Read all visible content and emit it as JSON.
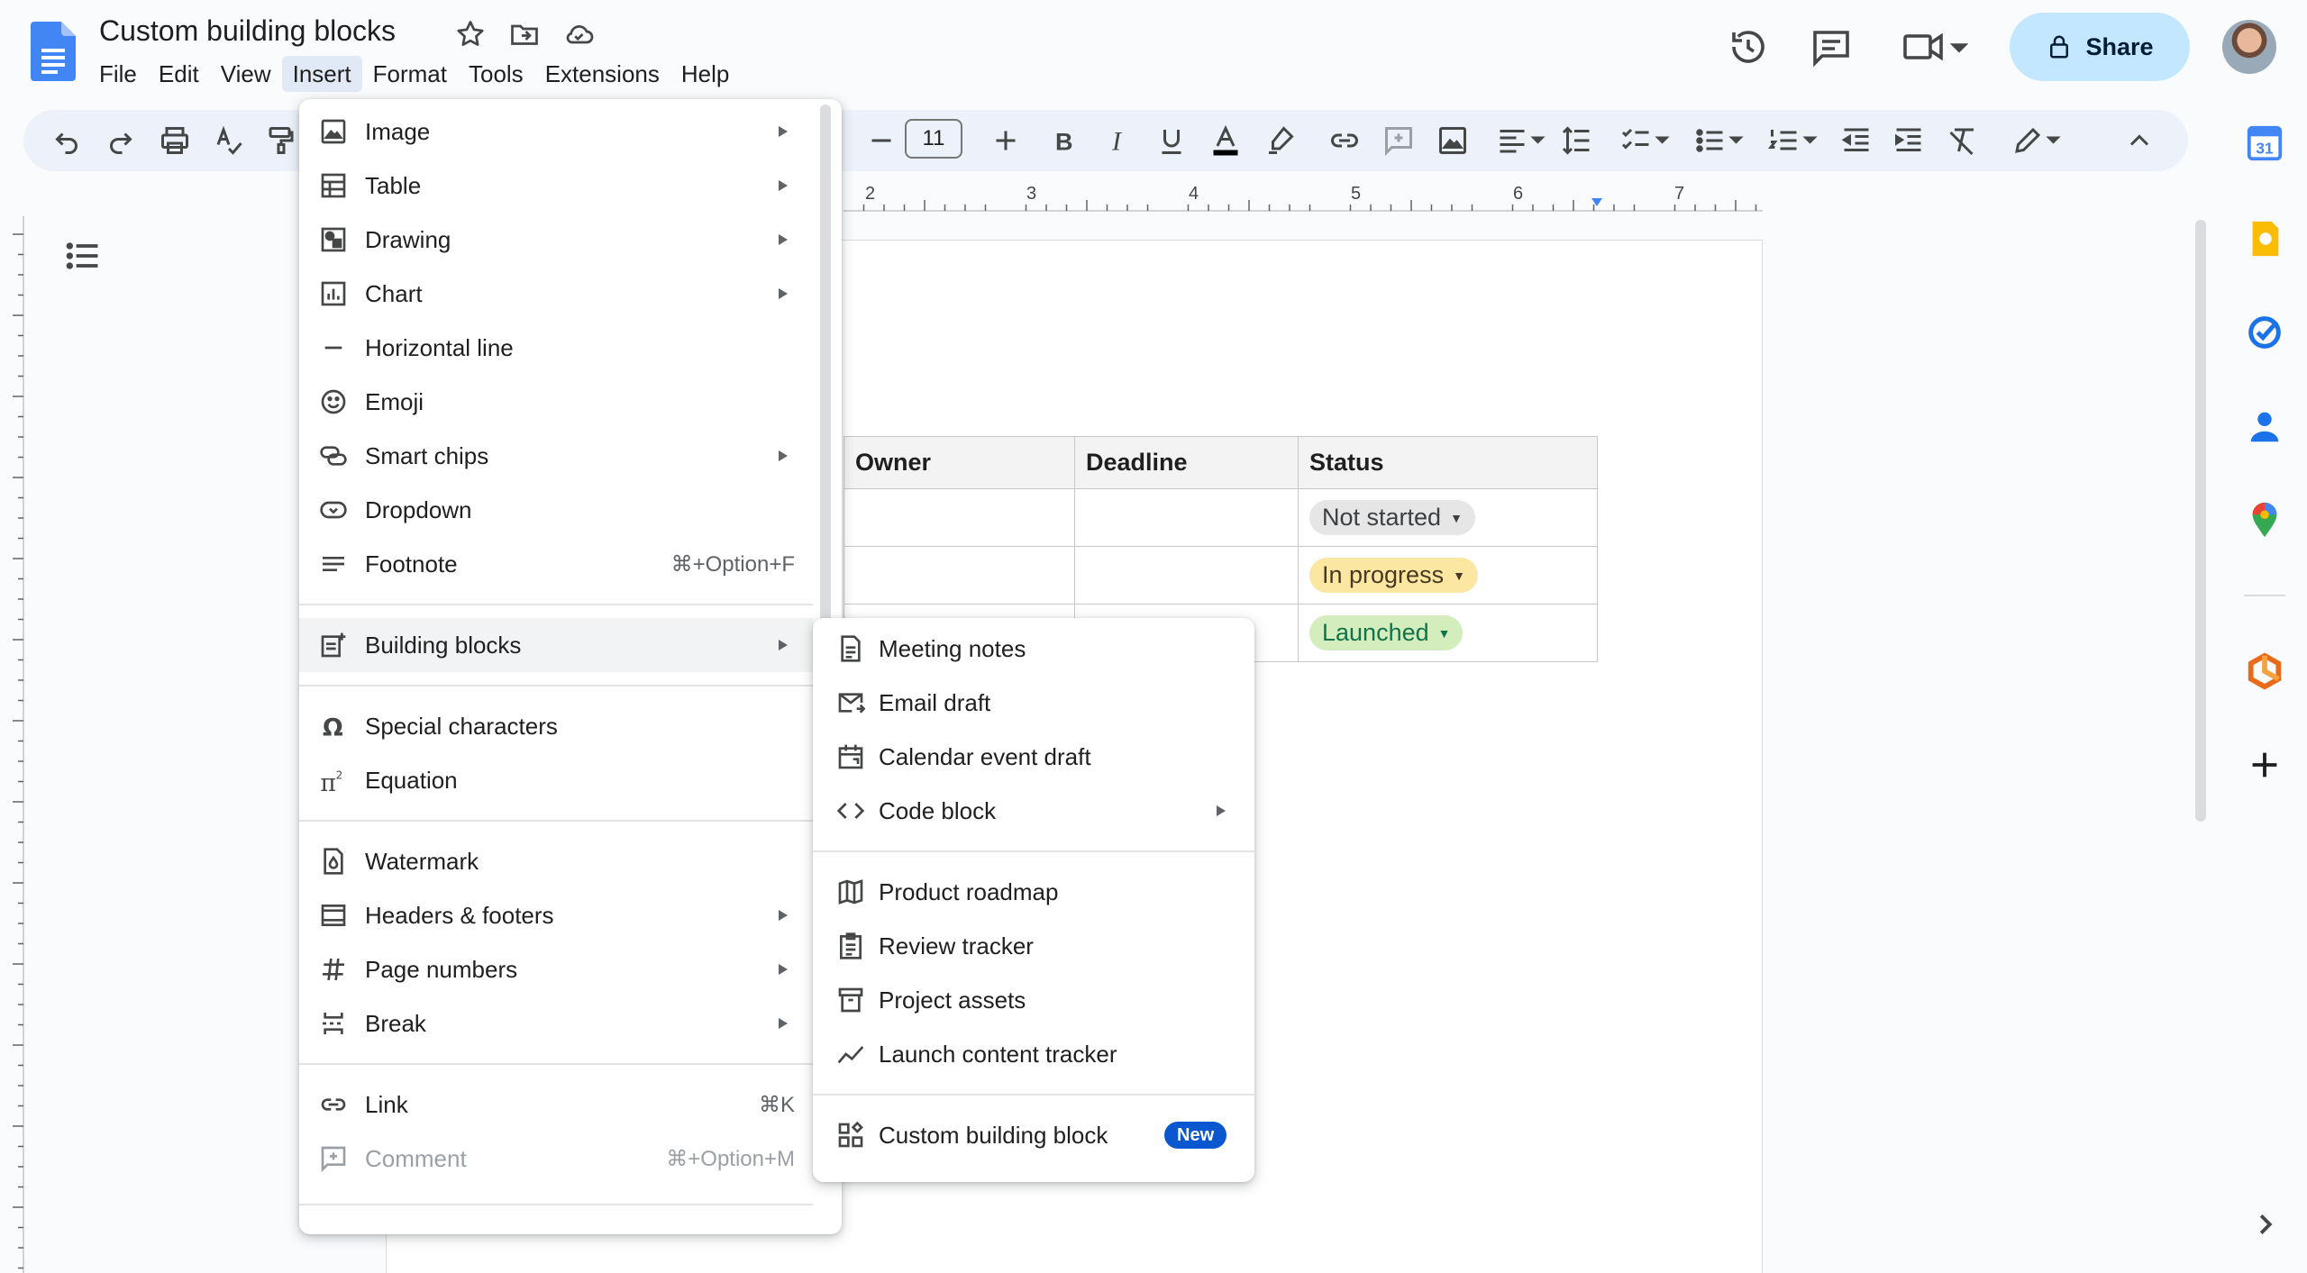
{
  "document": {
    "title": "Custom building blocks"
  },
  "menubar": {
    "items": [
      "File",
      "Edit",
      "View",
      "Insert",
      "Format",
      "Tools",
      "Extensions",
      "Help"
    ]
  },
  "header": {
    "share_label": "Share"
  },
  "toolbar": {
    "font_size": "11"
  },
  "ruler": {
    "numbers": [
      "2",
      "3",
      "4",
      "5",
      "6",
      "7"
    ]
  },
  "table": {
    "headers": [
      "Owner",
      "Deadline",
      "Status"
    ],
    "rows": [
      {
        "owner": "",
        "deadline": "",
        "status": "Not started",
        "status_color": "#e6e6e6",
        "status_text_color": "#3c4043"
      },
      {
        "owner": "",
        "deadline": "",
        "status": "In progress",
        "status_color": "#fbe7a1",
        "status_text_color": "#473822"
      },
      {
        "owner": "",
        "deadline": "",
        "status": "Launched",
        "status_color": "#d4edbc",
        "status_text_color": "#11734b"
      }
    ]
  },
  "insert_menu": {
    "items": [
      {
        "label": "Image",
        "icon": "image-icon",
        "submenu": true,
        "shortcut": ""
      },
      {
        "label": "Table",
        "icon": "table-icon",
        "submenu": true,
        "shortcut": ""
      },
      {
        "label": "Drawing",
        "icon": "drawing-icon",
        "submenu": true,
        "shortcut": ""
      },
      {
        "label": "Chart",
        "icon": "chart-icon",
        "submenu": true,
        "shortcut": ""
      },
      {
        "label": "Horizontal line",
        "icon": "horizontal-line-icon",
        "submenu": false,
        "shortcut": ""
      },
      {
        "label": "Emoji",
        "icon": "emoji-icon",
        "submenu": false,
        "shortcut": ""
      },
      {
        "label": "Smart chips",
        "icon": "smart-chips-icon",
        "submenu": true,
        "shortcut": ""
      },
      {
        "label": "Dropdown",
        "icon": "dropdown-icon",
        "submenu": false,
        "shortcut": ""
      },
      {
        "label": "Footnote",
        "icon": "footnote-icon",
        "submenu": false,
        "shortcut": "⌘+Option+F"
      },
      {
        "label": "Building blocks",
        "icon": "building-blocks-icon",
        "submenu": true,
        "shortcut": ""
      },
      {
        "label": "Special characters",
        "icon": "omega-icon",
        "submenu": false,
        "shortcut": ""
      },
      {
        "label": "Equation",
        "icon": "equation-icon",
        "submenu": false,
        "shortcut": ""
      },
      {
        "label": "Watermark",
        "icon": "watermark-icon",
        "submenu": false,
        "shortcut": ""
      },
      {
        "label": "Headers & footers",
        "icon": "headers-footers-icon",
        "submenu": true,
        "shortcut": ""
      },
      {
        "label": "Page numbers",
        "icon": "hash-icon",
        "submenu": true,
        "shortcut": ""
      },
      {
        "label": "Break",
        "icon": "break-icon",
        "submenu": true,
        "shortcut": ""
      },
      {
        "label": "Link",
        "icon": "link-icon",
        "submenu": false,
        "shortcut": "⌘K"
      },
      {
        "label": "Comment",
        "icon": "comment-icon",
        "submenu": false,
        "shortcut": "⌘+Option+M",
        "disabled": true
      }
    ]
  },
  "building_blocks_menu": {
    "items": [
      {
        "label": "Meeting notes",
        "icon": "document-icon",
        "submenu": false
      },
      {
        "label": "Email draft",
        "icon": "email-icon",
        "submenu": false
      },
      {
        "label": "Calendar event draft",
        "icon": "calendar-icon",
        "submenu": false
      },
      {
        "label": "Code block",
        "icon": "code-icon",
        "submenu": true
      },
      {
        "label": "Product roadmap",
        "icon": "map-icon",
        "submenu": false
      },
      {
        "label": "Review tracker",
        "icon": "clipboard-icon",
        "submenu": false
      },
      {
        "label": "Project assets",
        "icon": "archive-icon",
        "submenu": false
      },
      {
        "label": "Launch content tracker",
        "icon": "trend-icon",
        "submenu": false
      },
      {
        "label": "Custom building block",
        "icon": "custom-block-icon",
        "submenu": false,
        "badge": "New"
      }
    ]
  },
  "colors": {
    "accent": "#0b57d0",
    "share_bg": "#c2e7ff",
    "toolbar_bg": "#edf2fa",
    "menu_highlight": "#e2e9f6"
  }
}
